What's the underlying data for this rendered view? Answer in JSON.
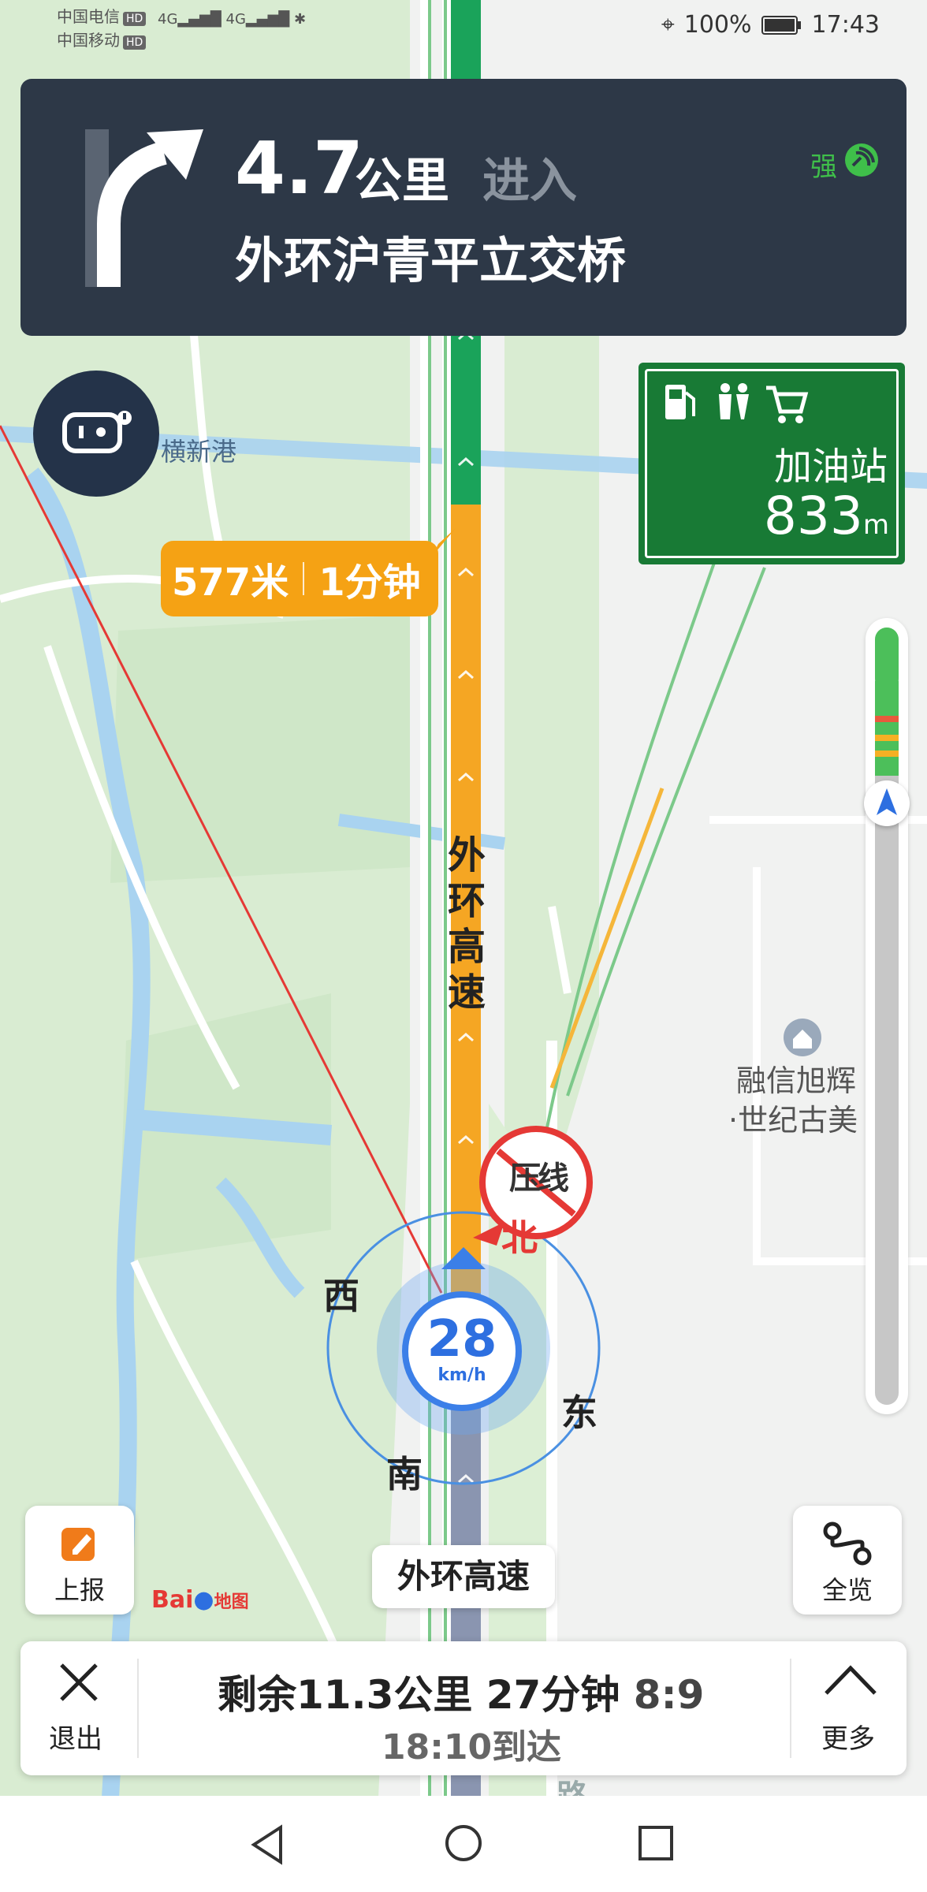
{
  "status_bar": {
    "carrier1": "中国电信",
    "carrier2": "中国移动",
    "hd": "HD",
    "net": "4G",
    "battery": "100%",
    "time": "17:43"
  },
  "guidance": {
    "distance_value": "4.7",
    "distance_unit": "公里",
    "action": "进入",
    "road": "外环沪青平立交桥",
    "signal": "强",
    "turn_icon": "turn-right-arrow-icon"
  },
  "service_sign": {
    "label": "加油站",
    "distance": "833",
    "unit": "m",
    "icons": [
      "fuel-icon",
      "restroom-icon",
      "shopping-cart-icon"
    ]
  },
  "traffic_bubble": {
    "distance": "577米",
    "time": "1分钟"
  },
  "map": {
    "road_vertical_label": [
      "外",
      "环",
      "高",
      "速"
    ],
    "water_label": "横新港",
    "poi_line1": "融信旭辉",
    "poi_line2": "·世纪古美",
    "camera_sign_text": "压线",
    "compass": {
      "north": "北",
      "south": "南",
      "east": "东",
      "west": "西"
    },
    "speed": "28",
    "speed_unit": "km/h",
    "bottom_road_fragment": "路"
  },
  "controls": {
    "report_label": "上报",
    "overview_label": "全览",
    "current_road": "外环高速",
    "logo_text": "Bai",
    "logo_suffix": "地图"
  },
  "bottom_panel": {
    "exit_label": "退出",
    "summary": "剩余11.3公里 27分钟",
    "summary_extra": "8:9",
    "arrival": "18:10到达",
    "more_label": "更多"
  },
  "colors": {
    "route_green": "#1aa35a",
    "route_orange": "#f5a623",
    "banner_bg": "#2d3847",
    "sign_green": "#187a35",
    "accent_blue": "#3b7fe8"
  }
}
